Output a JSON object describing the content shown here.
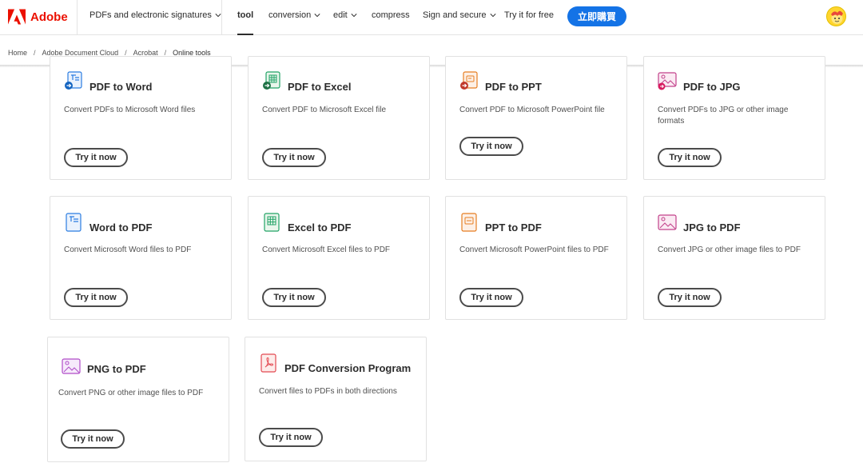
{
  "brand": {
    "name": "Adobe",
    "logo_color": "#eb1000"
  },
  "nav": {
    "items": [
      {
        "label": "PDFs and electronic signatures",
        "has_dropdown": true
      },
      {
        "label": "tool",
        "active": true
      },
      {
        "label": "conversion",
        "has_dropdown": true
      },
      {
        "label": "edit",
        "has_dropdown": true
      },
      {
        "label": "compress"
      },
      {
        "label": "Sign and secure",
        "has_dropdown": true
      },
      {
        "label": "Try it for free"
      }
    ],
    "buy_label": "立即購買",
    "buy_color": "#1473e6"
  },
  "breadcrumb": [
    "Home",
    "Adobe Document Cloud",
    "Acrobat",
    "Online tools"
  ],
  "cards": [
    {
      "title": "PDF to Word",
      "desc": "Convert PDFs to Microsoft Word files",
      "button": "Try it now",
      "icon": "pdf-to-word-icon"
    },
    {
      "title": "PDF to Excel",
      "desc": "Convert PDF to Microsoft Excel file",
      "button": "Try it now",
      "icon": "pdf-to-excel-icon"
    },
    {
      "title": "PDF to PPT",
      "desc": "Convert PDF to Microsoft PowerPoint file",
      "button": "Try it now",
      "icon": "pdf-to-ppt-icon"
    },
    {
      "title": "PDF to JPG",
      "desc": "Convert PDFs to JPG or other image formats",
      "button": "Try it now",
      "icon": "pdf-to-jpg-icon"
    },
    {
      "title": "Word to PDF",
      "desc": "Convert Microsoft Word files to PDF",
      "button": "Try it now",
      "icon": "word-to-pdf-icon"
    },
    {
      "title": "Excel to PDF",
      "desc": "Convert Microsoft Excel files to PDF",
      "button": "Try it now",
      "icon": "excel-to-pdf-icon"
    },
    {
      "title": "PPT to PDF",
      "desc": "Convert Microsoft PowerPoint files to PDF",
      "button": "Try it now",
      "icon": "ppt-to-pdf-icon"
    },
    {
      "title": "JPG to PDF",
      "desc": "Convert JPG or other image files to PDF",
      "button": "Try it now",
      "icon": "jpg-to-pdf-icon"
    },
    {
      "title": "PNG to PDF",
      "desc": "Convert PNG or other image files to PDF",
      "button": "Try it now",
      "icon": "png-to-pdf-icon"
    },
    {
      "title": "PDF Conversion Program",
      "desc": "Convert files to PDFs in both directions",
      "button": "Try it now",
      "icon": "pdf-conversion-icon"
    }
  ]
}
